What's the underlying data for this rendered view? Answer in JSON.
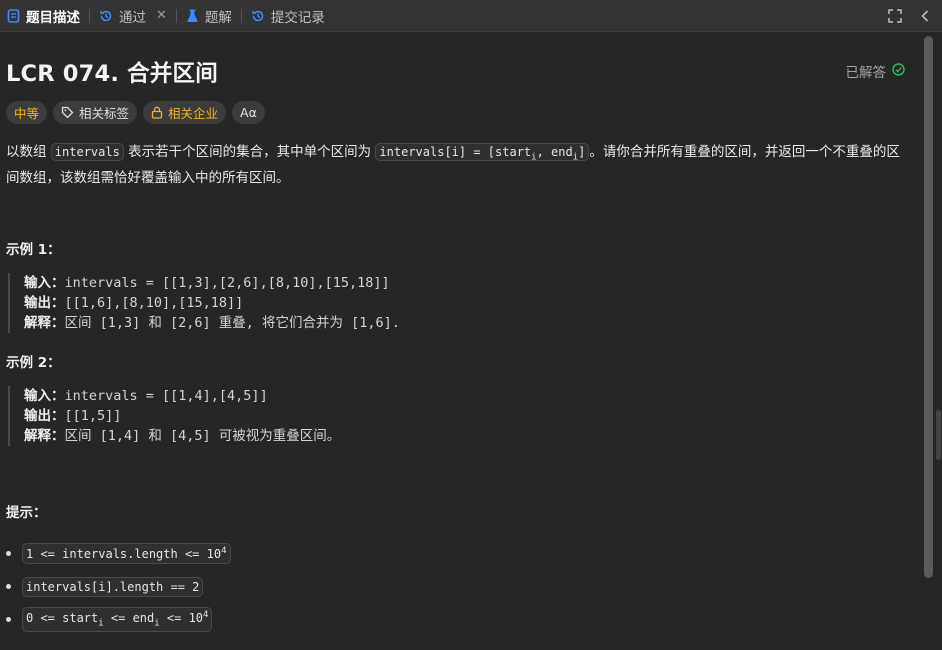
{
  "tabs": [
    {
      "label": "题目描述",
      "active": true
    },
    {
      "label": "通过",
      "closable": true
    },
    {
      "label": "题解"
    },
    {
      "label": "提交记录"
    }
  ],
  "problem": {
    "title": "LCR 074. 合并区间",
    "status": "已解答",
    "tags": {
      "difficulty": "中等",
      "related_tags": "相关标签",
      "related_companies": "相关企业",
      "font_toggle": "Aα"
    },
    "description": {
      "p1": "以数组",
      "code1": "intervals",
      "p2": "表示若干个区间的集合，其中单个区间为",
      "code2_a": "intervals[i] = [start",
      "code2_sub1": "i",
      "code2_b": ", end",
      "code2_sub2": "i",
      "code2_c": "]",
      "p3": "。请你合并所有重叠的区间，并返回一个不重叠的区间数组，该数组需恰好覆盖输入中的所有区间。"
    }
  },
  "examples": [
    {
      "title": "示例 1：",
      "input_label": "输入：",
      "input": "intervals = [[1,3],[2,6],[8,10],[15,18]]",
      "output_label": "输出：",
      "output": "[[1,6],[8,10],[15,18]]",
      "explain_label": "解释：",
      "explain": "区间 [1,3] 和 [2,6] 重叠, 将它们合并为 [1,6]."
    },
    {
      "title": "示例 2：",
      "input_label": "输入：",
      "input": "intervals = [[1,4],[4,5]]",
      "output_label": "输出：",
      "output": "[[1,5]]",
      "explain_label": "解释：",
      "explain": "区间 [1,4] 和 [4,5] 可被视为重叠区间。"
    }
  ],
  "hints": {
    "title": "提示：",
    "h1_a": "1 <= intervals.length <= 10",
    "h1_sup": "4",
    "h2": "intervals[i].length == 2",
    "h3_a": "0 <= start",
    "h3_sub1": "i",
    "h3_b": " <= end",
    "h3_sub2": "i",
    "h3_c": " <= 10",
    "h3_sup": "4"
  },
  "colors": {
    "background": "#262626",
    "tabbar": "#333333",
    "difficulty": "#ffb800",
    "solved_check": "#2cbb5d",
    "tab_icon_blue": "#3d8bfd"
  },
  "icons": [
    "description-icon",
    "history-icon",
    "close-icon",
    "flask-icon",
    "clock-icon",
    "fullscreen-icon",
    "chevron-left-icon",
    "check-circle-icon",
    "tag-icon",
    "lock-icon"
  ]
}
